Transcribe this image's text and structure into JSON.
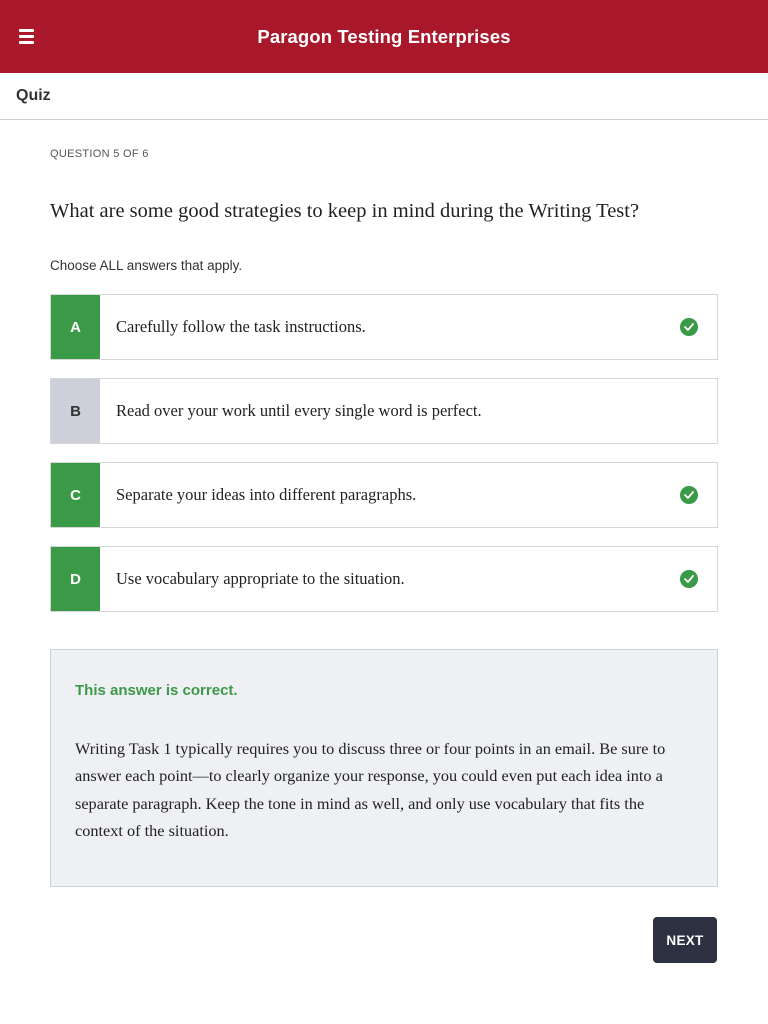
{
  "header": {
    "app_title": "Paragon Testing Enterprises",
    "menu_icon": "hamburger-menu-icon"
  },
  "subheader": {
    "title": "Quiz"
  },
  "quiz": {
    "counter": "QUESTION 5 OF 6",
    "question": "What are some good strategies to keep in mind during the Writing Test?",
    "instructions": "Choose ALL answers that apply.",
    "options": [
      {
        "letter": "A",
        "text": "Carefully follow the task instructions.",
        "selected": true
      },
      {
        "letter": "B",
        "text": "Read over your work until every single word is perfect.",
        "selected": false
      },
      {
        "letter": "C",
        "text": "Separate your ideas into different paragraphs.",
        "selected": true
      },
      {
        "letter": "D",
        "text": "Use vocabulary appropriate to the situation.",
        "selected": true
      }
    ],
    "feedback": {
      "title": "This answer is correct.",
      "body": "Writing Task 1 typically requires you to discuss three or four points in an email. Be sure to answer each point—to clearly organize your response, you could even put each idea into a separate paragraph. Keep the tone in mind as well, and only use vocabulary that fits the context of the situation."
    },
    "next_label": "NEXT"
  },
  "colors": {
    "brand": "#a8182a",
    "correct": "#3a9a48",
    "unselected": "#cdd0da",
    "button": "#2d3142"
  }
}
